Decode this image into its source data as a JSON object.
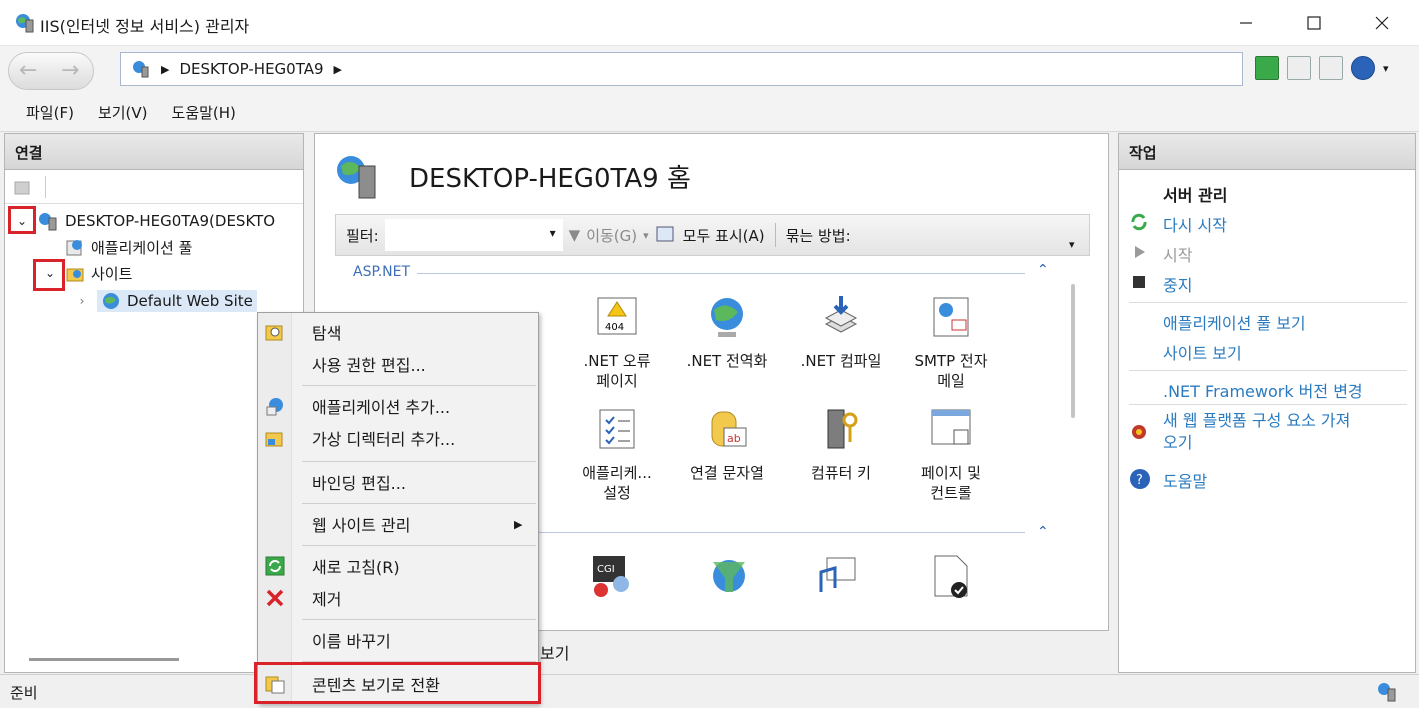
{
  "window": {
    "title": "IIS(인터넷 정보 서비스) 관리자"
  },
  "address": {
    "server": "DESKTOP-HEG0TA9"
  },
  "menu": [
    "파일(F)",
    "보기(V)",
    "도움말(H)"
  ],
  "connections": {
    "title": "연결",
    "server_node": "DESKTOP-HEG0TA9(DESKTO",
    "app_pools": "애플리케이션 풀",
    "sites": "사이트",
    "default_site": "Default Web Site"
  },
  "main": {
    "home_title": "DESKTOP-HEG0TA9 홈",
    "filter_label": "필터:",
    "go_label": "이동(G)",
    "show_all_label": "모두 표시(A)",
    "group_label": "묶는 방법:",
    "section1": "ASP.NET",
    "features_row1": [
      ".NET 오류\n페이지",
      ".NET 전역화",
      ".NET 컴파일",
      "SMTP 전자\n메일"
    ],
    "features_row2": [
      "애플리케...\n설정",
      "연결 문자열",
      "컴퓨터 키",
      "페이지 및\n컨트롤"
    ],
    "bottom_tab": "보기"
  },
  "actions": {
    "title": "작업",
    "server_manage": "서버 관리",
    "restart": "다시 시작",
    "start": "시작",
    "stop": "중지",
    "view_app_pools": "애플리케이션 풀 보기",
    "view_sites": "사이트 보기",
    "change_framework": ".NET Framework 버전 변경",
    "get_new_components": "새 웹 플랫폼 구성 요소 가져\n오기",
    "help": "도움말"
  },
  "context_menu": {
    "explore": "탐색",
    "edit_permissions": "사용 권한 편집...",
    "add_application": "애플리케이션 추가...",
    "add_virtual_dir": "가상 디렉터리 추가...",
    "edit_bindings": "바인딩 편집...",
    "manage_website": "웹 사이트 관리",
    "refresh": "새로 고침(R)",
    "remove": "제거",
    "rename": "이름 바꾸기",
    "switch_content_view": "콘텐츠 보기로 전환"
  },
  "status": {
    "text": "준비"
  }
}
